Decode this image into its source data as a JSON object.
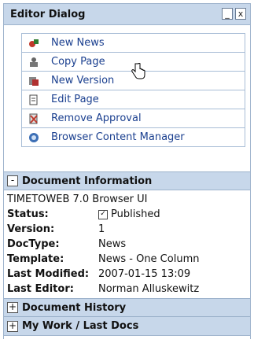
{
  "dialog": {
    "title": "Editor Dialog",
    "minimize_label": "_",
    "close_label": "x"
  },
  "actions": [
    {
      "label": "New News",
      "icon": "new-news-icon",
      "color": "#c0392b"
    },
    {
      "label": "Copy Page",
      "icon": "copy-page-icon",
      "color": "#555555"
    },
    {
      "label": "New Version",
      "icon": "new-version-icon",
      "color": "#b03030"
    },
    {
      "label": "Edit Page",
      "icon": "edit-page-icon",
      "color": "#444444"
    },
    {
      "label": "Remove Approval",
      "icon": "remove-approval-icon",
      "color": "#c0392b"
    },
    {
      "label": "Browser Content Manager",
      "icon": "browser-content-manager-icon",
      "color": "#3d6fb5"
    }
  ],
  "document_info": {
    "toggle": "-",
    "title": "Document Information",
    "header_line": "TIMETOWEB 7.0 Browser UI",
    "rows": [
      {
        "key": "Status:",
        "value": "Published",
        "checkbox": "✓"
      },
      {
        "key": "Version:",
        "value": "1"
      },
      {
        "key": "DocType:",
        "value": "News"
      },
      {
        "key": "Template:",
        "value": "News - One Column"
      },
      {
        "key": "Last Modified:",
        "value": "2007-01-15 13:09"
      },
      {
        "key": "Last Editor:",
        "value": "Norman Alluskewitz"
      }
    ]
  },
  "document_history": {
    "toggle": "+",
    "title": "Document History"
  },
  "my_work": {
    "toggle": "+",
    "title": "My Work / Last Docs"
  }
}
